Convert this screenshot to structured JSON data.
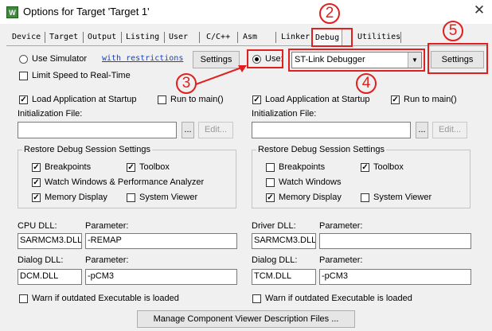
{
  "window": {
    "title": "Options for Target 'Target 1'",
    "app_icon": "W",
    "close": "✕"
  },
  "tabs": [
    "Device",
    "Target",
    "Output",
    "Listing",
    "User",
    "C/C++",
    "Asm",
    "Linker",
    "Debug",
    "Utilities"
  ],
  "active_tab": "Debug",
  "annotations": {
    "n2": "2",
    "n3": "3",
    "n4": "4",
    "n5": "5",
    "color": "#e02020"
  },
  "left": {
    "use_simulator": "Use Simulator",
    "restrictions_link": "with restrictions",
    "settings": "Settings",
    "limit_speed": "Limit Speed to Real-Time",
    "load_app": "Load Application at Startup",
    "run_to_main": "Run to main()",
    "init_file_label": "Initialization File:",
    "browse": "...",
    "edit": "Edit...",
    "restore_group": "Restore Debug Session Settings",
    "breakpoints": "Breakpoints",
    "toolbox": "Toolbox",
    "watch_windows": "Watch Windows & Performance Analyzer",
    "memory_display": "Memory Display",
    "system_viewer": "System Viewer",
    "cpu_dll_label": "CPU DLL:",
    "parameter_label": "Parameter:",
    "cpu_dll": "SARMCM3.DLL",
    "cpu_param": "-REMAP",
    "dialog_dll_label": "Dialog DLL:",
    "dialog_dll": "DCM.DLL",
    "dialog_param": "-pCM3",
    "warn": "Warn if outdated Executable is loaded"
  },
  "right": {
    "use": "Use:",
    "debugger": "ST-Link Debugger",
    "settings": "Settings",
    "load_app": "Load Application at Startup",
    "run_to_main": "Run to main()",
    "init_file_label": "Initialization File:",
    "browse": "...",
    "edit": "Edit...",
    "restore_group": "Restore Debug Session Settings",
    "breakpoints": "Breakpoints",
    "toolbox": "Toolbox",
    "watch_windows": "Watch Windows",
    "memory_display": "Memory Display",
    "system_viewer": "System Viewer",
    "driver_dll_label": "Driver DLL:",
    "parameter_label": "Parameter:",
    "driver_dll": "SARMCM3.DLL",
    "driver_param": "",
    "dialog_dll_label": "Dialog DLL:",
    "dialog_dll": "TCM.DLL",
    "dialog_param": "-pCM3",
    "warn": "Warn if outdated Executable is loaded"
  },
  "manage_button": "Manage Component Viewer Description Files ..."
}
